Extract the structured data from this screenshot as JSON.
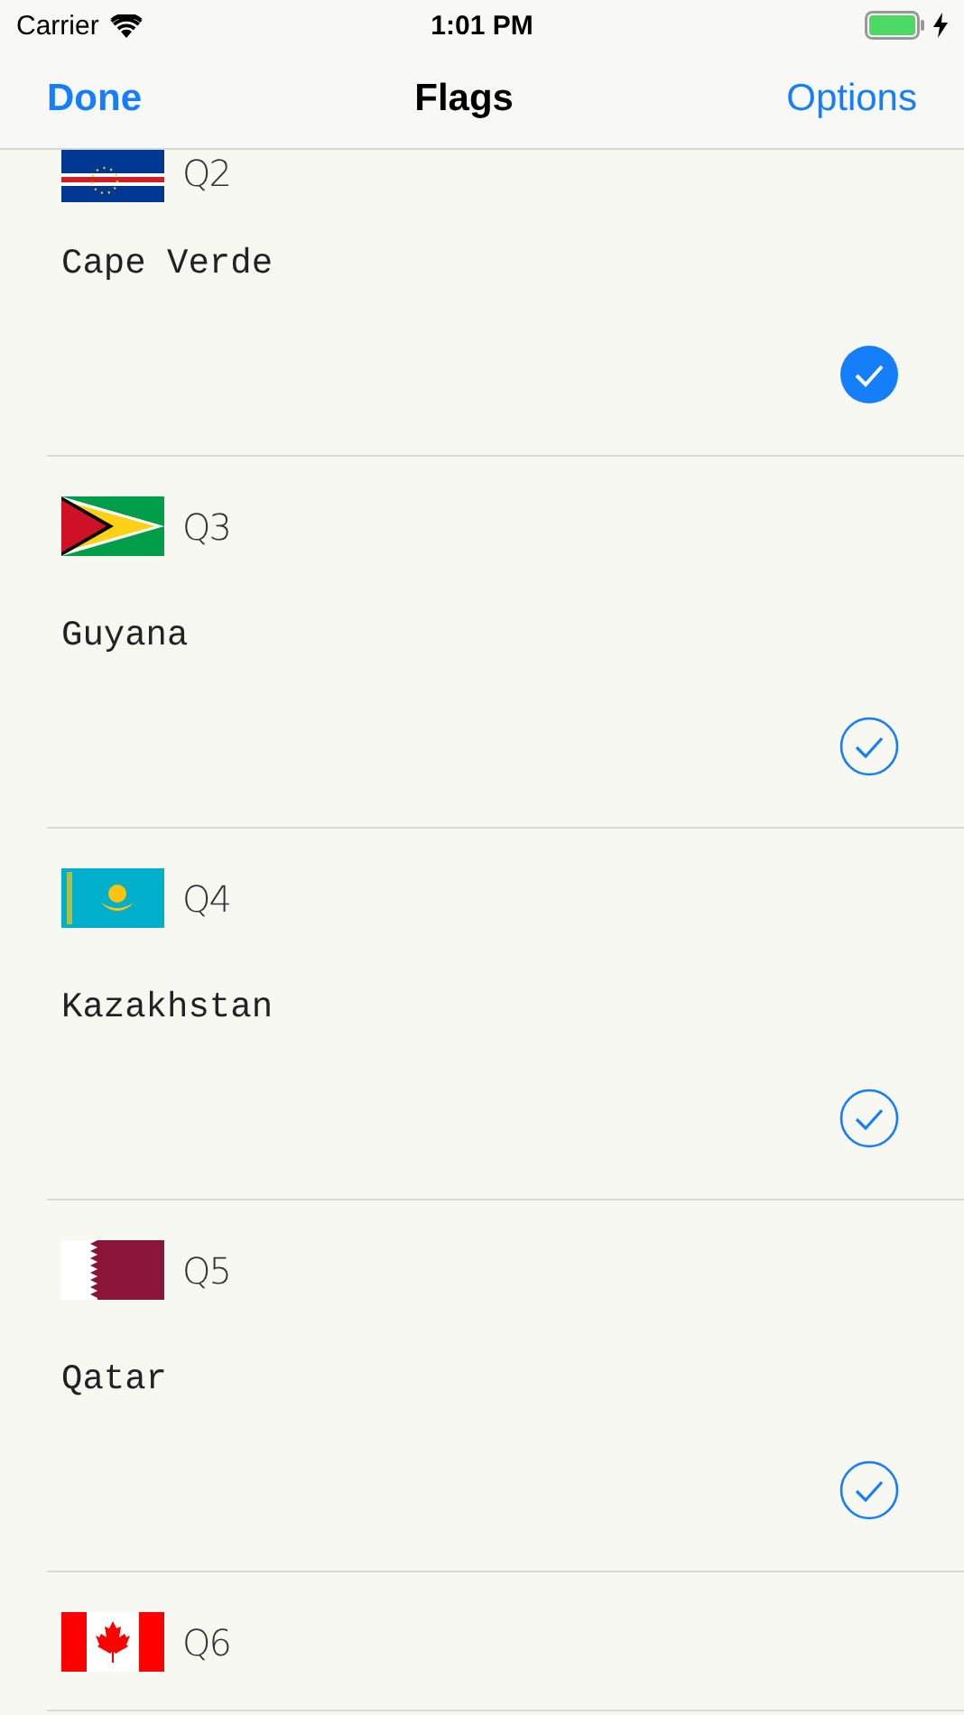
{
  "status_bar": {
    "carrier": "Carrier",
    "time": "1:01 PM"
  },
  "nav_bar": {
    "left_button": "Done",
    "title": "Flags",
    "right_button": "Options"
  },
  "questions": [
    {
      "label": "Q2",
      "answer": "Cape Verde",
      "checked": true
    },
    {
      "label": "Q3",
      "answer": "Guyana",
      "checked": false
    },
    {
      "label": "Q4",
      "answer": "Kazakhstan",
      "checked": false
    },
    {
      "label": "Q5",
      "answer": "Qatar",
      "checked": false
    },
    {
      "label": "Q6"
    }
  ]
}
